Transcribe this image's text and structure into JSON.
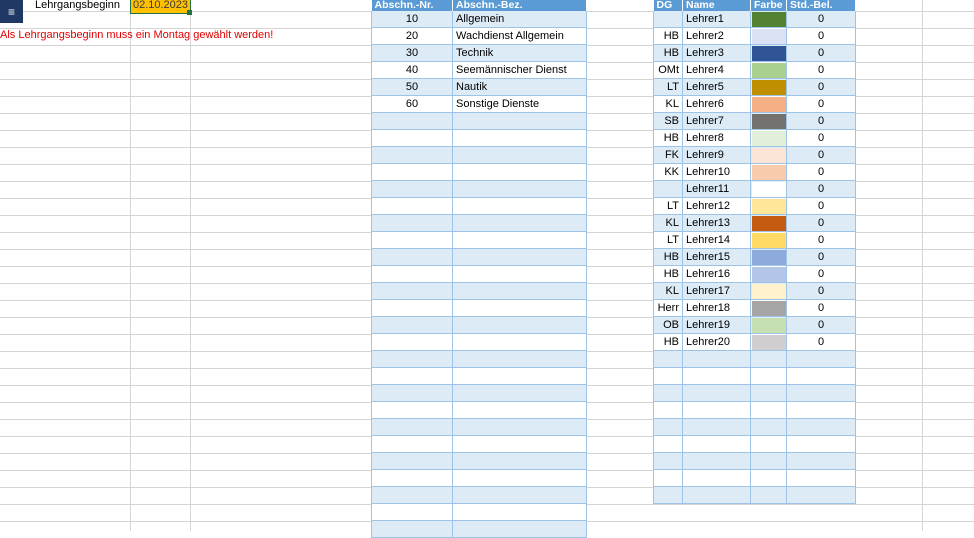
{
  "sheet": {
    "start_label": "Lehrgangsbeginn",
    "start_value": "02.10.2023",
    "warning": "Als Lehrgangsbeginn muss ein Montag gewählt werden!",
    "menu_icon": "menu-icon"
  },
  "sections": {
    "headers": [
      "Abschn.-Nr.",
      "Abschn.-Bez."
    ],
    "rows": [
      {
        "nr": "10",
        "bez": "Allgemein"
      },
      {
        "nr": "20",
        "bez": "Wachdienst Allgemein"
      },
      {
        "nr": "30",
        "bez": "Technik"
      },
      {
        "nr": "40",
        "bez": "Seemännischer Dienst"
      },
      {
        "nr": "50",
        "bez": "Nautik"
      },
      {
        "nr": "60",
        "bez": "Sonstige Dienste"
      },
      {
        "nr": "",
        "bez": ""
      },
      {
        "nr": "",
        "bez": ""
      },
      {
        "nr": "",
        "bez": ""
      },
      {
        "nr": "",
        "bez": ""
      },
      {
        "nr": "",
        "bez": ""
      },
      {
        "nr": "",
        "bez": ""
      },
      {
        "nr": "",
        "bez": ""
      },
      {
        "nr": "",
        "bez": ""
      },
      {
        "nr": "",
        "bez": ""
      },
      {
        "nr": "",
        "bez": ""
      },
      {
        "nr": "",
        "bez": ""
      },
      {
        "nr": "",
        "bez": ""
      },
      {
        "nr": "",
        "bez": ""
      },
      {
        "nr": "",
        "bez": ""
      },
      {
        "nr": "",
        "bez": ""
      },
      {
        "nr": "",
        "bez": ""
      },
      {
        "nr": "",
        "bez": ""
      },
      {
        "nr": "",
        "bez": ""
      },
      {
        "nr": "",
        "bez": ""
      },
      {
        "nr": "",
        "bez": ""
      },
      {
        "nr": "",
        "bez": ""
      },
      {
        "nr": "",
        "bez": ""
      },
      {
        "nr": "",
        "bez": ""
      },
      {
        "nr": "",
        "bez": ""
      },
      {
        "nr": "",
        "bez": ""
      }
    ]
  },
  "teachers": {
    "headers": [
      "DG",
      "Name",
      "Farbe",
      "Std.-Bel."
    ],
    "rows": [
      {
        "dg": "",
        "name": "Lehrer1",
        "color": "#548235",
        "hours": "0"
      },
      {
        "dg": "HB",
        "name": "Lehrer2",
        "color": "#d9e1f2",
        "hours": "0"
      },
      {
        "dg": "HB",
        "name": "Lehrer3",
        "color": "#2f5597",
        "hours": "0"
      },
      {
        "dg": "OMt",
        "name": "Lehrer4",
        "color": "#a9d08e",
        "hours": "0"
      },
      {
        "dg": "LT",
        "name": "Lehrer5",
        "color": "#bf8f00",
        "hours": "0"
      },
      {
        "dg": "KL",
        "name": "Lehrer6",
        "color": "#f4b084",
        "hours": "0"
      },
      {
        "dg": "SB",
        "name": "Lehrer7",
        "color": "#767171",
        "hours": "0"
      },
      {
        "dg": "HB",
        "name": "Lehrer8",
        "color": "#e2efda",
        "hours": "0"
      },
      {
        "dg": "FK",
        "name": "Lehrer9",
        "color": "#fce4d6",
        "hours": "0"
      },
      {
        "dg": "KK",
        "name": "Lehrer10",
        "color": "#f8cbad",
        "hours": "0"
      },
      {
        "dg": "",
        "name": "Lehrer11",
        "color": "#ffffff",
        "hours": "0"
      },
      {
        "dg": "LT",
        "name": "Lehrer12",
        "color": "#ffe699",
        "hours": "0"
      },
      {
        "dg": "KL",
        "name": "Lehrer13",
        "color": "#c55a11",
        "hours": "0"
      },
      {
        "dg": "LT",
        "name": "Lehrer14",
        "color": "#ffd966",
        "hours": "0"
      },
      {
        "dg": "HB",
        "name": "Lehrer15",
        "color": "#8ea9db",
        "hours": "0"
      },
      {
        "dg": "HB",
        "name": "Lehrer16",
        "color": "#b4c6e7",
        "hours": "0"
      },
      {
        "dg": "KL",
        "name": "Lehrer17",
        "color": "#fff2cc",
        "hours": "0"
      },
      {
        "dg": "Herr",
        "name": "Lehrer18",
        "color": "#a5a5a5",
        "hours": "0"
      },
      {
        "dg": "OB",
        "name": "Lehrer19",
        "color": "#c6e0b4",
        "hours": "0"
      },
      {
        "dg": "HB",
        "name": "Lehrer20",
        "color": "#d0cece",
        "hours": "0"
      },
      {
        "dg": "",
        "name": "",
        "color": "",
        "hours": ""
      },
      {
        "dg": "",
        "name": "",
        "color": "",
        "hours": ""
      },
      {
        "dg": "",
        "name": "",
        "color": "",
        "hours": ""
      },
      {
        "dg": "",
        "name": "",
        "color": "",
        "hours": ""
      },
      {
        "dg": "",
        "name": "",
        "color": "",
        "hours": ""
      },
      {
        "dg": "",
        "name": "",
        "color": "",
        "hours": ""
      },
      {
        "dg": "",
        "name": "",
        "color": "",
        "hours": ""
      },
      {
        "dg": "",
        "name": "",
        "color": "",
        "hours": ""
      },
      {
        "dg": "",
        "name": "",
        "color": "",
        "hours": ""
      }
    ]
  },
  "colors": {
    "header_bg": "#5b9bd5",
    "band": "#ddebf7",
    "date_fill": "#ffc000",
    "warning": "#e00000"
  }
}
